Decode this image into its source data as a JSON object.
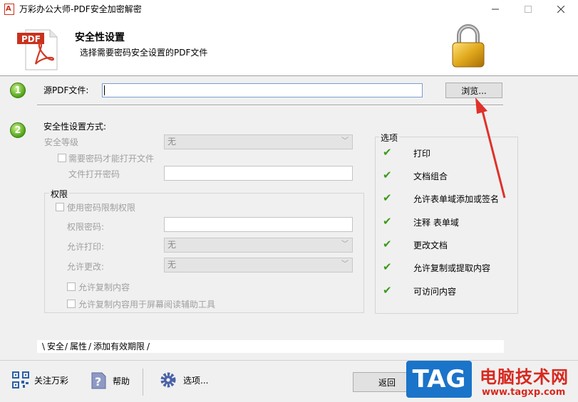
{
  "window": {
    "title": "万彩办公大师-PDF安全加密解密",
    "app_icon_glyph": "A"
  },
  "header": {
    "pdf_icon_label": "PDF",
    "title": "安全性设置",
    "subtitle": "选择需要密码安全设置的PDF文件"
  },
  "steps": {
    "step1": "1",
    "step2": "2"
  },
  "source": {
    "label": "源PDF文件:",
    "value": "",
    "browse_label": "浏览..."
  },
  "security": {
    "method_label": "安全性设置方式:",
    "level_label": "安全等级",
    "level_value": "无",
    "need_password_label": "需要密码才能打开文件",
    "need_password_checked": false,
    "open_password_label": "文件打开密码",
    "open_password_value": ""
  },
  "permissions": {
    "group_title": "权限",
    "use_password_label": "使用密码限制权限",
    "use_password_checked": false,
    "perm_password_label": "权限密码:",
    "perm_password_value": "",
    "allow_print_label": "允许打印:",
    "allow_print_value": "无",
    "allow_change_label": "允许更改:",
    "allow_change_value": "无",
    "allow_copy_label": "允许复制内容",
    "allow_copy_checked": false,
    "allow_copy_reader_label": "允许复制内容用于屏幕阅读辅助工具",
    "allow_copy_reader_checked": false
  },
  "options": {
    "title": "选项",
    "check_glyph": "✔",
    "check_color": "#3a9b1c",
    "items": [
      {
        "label": "打印",
        "checked": true
      },
      {
        "label": "文档组合",
        "checked": true
      },
      {
        "label": "允许表单域添加或签名",
        "checked": true
      },
      {
        "label": "注释 表单域",
        "checked": true
      },
      {
        "label": "更改文档",
        "checked": true
      },
      {
        "label": "允许复制或提取内容",
        "checked": true
      },
      {
        "label": "可访问内容",
        "checked": true
      }
    ]
  },
  "tabs": {
    "security": "安全",
    "properties": "属性",
    "expiry": "添加有效期限"
  },
  "bottom": {
    "follow_label": "关注万彩",
    "help_label": "帮助",
    "options_label": "选项...",
    "back_label": "返回"
  },
  "watermark": {
    "tag": "TAG",
    "title": "电脑技术网",
    "url": "www.tagxp.com"
  },
  "colors": {
    "accent_arrow": "#e0312a",
    "input_border": "#7a9cd3",
    "watermark_blue": "#1a74c9",
    "watermark_red": "#d7281e"
  }
}
